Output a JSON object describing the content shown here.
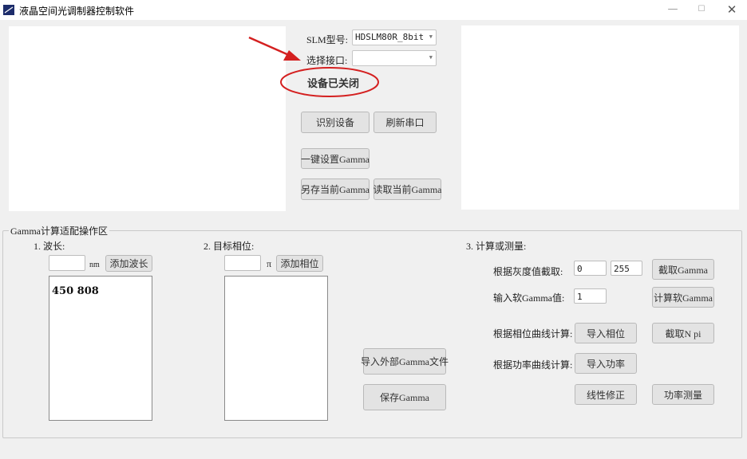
{
  "window": {
    "title": "液晶空间光调制器控制软件",
    "min_icon": "—",
    "max_icon": "☐",
    "close_icon": "✕"
  },
  "device": {
    "model_label": "SLM型号:",
    "model_value": "HDSLM80R_8bit",
    "port_label": "选择接口:",
    "port_value": "",
    "status": "设备已关闭",
    "identify_button": "识别设备",
    "refresh_button": "刷新串口",
    "one_click_gamma_button": "一键设置Gamma",
    "save_current_gamma_button": "另存当前Gamma",
    "read_current_gamma_button": "读取当前Gamma"
  },
  "gamma_group": {
    "title": "Gamma计算适配操作区",
    "wavelength": {
      "label": "1. 波长:",
      "input_value": "",
      "unit": "nm",
      "add_button": "添加波长",
      "list": [
        "450 808"
      ]
    },
    "phase": {
      "label": "2. 目标相位:",
      "input_value": "",
      "unit": "π",
      "add_button": "添加相位",
      "list": []
    },
    "import_external_button": "导入外部Gamma文件",
    "save_gamma_button": "保存Gamma",
    "calc": {
      "label": "3. 计算或测量:",
      "gray_label": "根据灰度值截取:",
      "gray_min": "0",
      "gray_max": "255",
      "cut_gamma_button": "截取Gamma",
      "soft_gamma_label": "输入软Gamma值:",
      "soft_gamma_value": "1",
      "calc_soft_gamma_button": "计算软Gamma",
      "phase_curve_label": "根据相位曲线计算:",
      "import_phase_button": "导入相位",
      "cut_npi_button": "截取N pi",
      "power_curve_label": "根据功率曲线计算:",
      "import_power_button": "导入功率",
      "linear_fix_button": "线性修正",
      "power_measure_button": "功率测量"
    }
  },
  "colors": {
    "annotation": "#d42020",
    "background": "#f0f0f0",
    "panel": "#ffffff",
    "button": "#e3e3e3"
  }
}
